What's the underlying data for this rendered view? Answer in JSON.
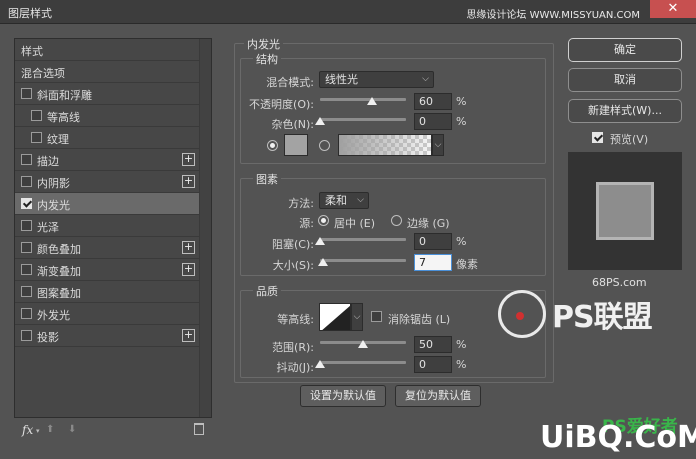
{
  "window": {
    "title": "图层样式",
    "watermark": "思缘设计论坛 WWW.MISSYUAN.COM",
    "close": "✕"
  },
  "styles_list": {
    "header": "样式",
    "blend_options": "混合选项",
    "items": [
      {
        "label": "斜面和浮雕",
        "checked": false
      },
      {
        "label": "等高线",
        "checked": false
      },
      {
        "label": "纹理",
        "checked": false
      },
      {
        "label": "描边",
        "checked": false
      },
      {
        "label": "内阴影",
        "checked": false
      },
      {
        "label": "内发光",
        "checked": true
      },
      {
        "label": "光泽",
        "checked": false
      },
      {
        "label": "颜色叠加",
        "checked": false
      },
      {
        "label": "渐变叠加",
        "checked": false
      },
      {
        "label": "图案叠加",
        "checked": false
      },
      {
        "label": "外发光",
        "checked": false
      },
      {
        "label": "投影",
        "checked": false
      }
    ],
    "fx": "fx",
    "fx_caret": "▾",
    "up_arrow": "⬆",
    "down_arrow": "⬇",
    "plus": "+"
  },
  "inner_glow": {
    "title": "内发光",
    "structure": {
      "title": "结构",
      "blend_mode_label": "混合模式:",
      "blend_mode_value": "线性光",
      "opacity_label": "不透明度(O):",
      "opacity_value": "60",
      "opacity_level": 0.6,
      "noise_label": "杂色(N):",
      "noise_value": "0",
      "noise_level": 0,
      "unit": "%",
      "swatch_color": "#a3a3a3"
    },
    "elements": {
      "title": "图素",
      "method_label": "方法:",
      "method_value": "柔和",
      "source_label": "源:",
      "source_center": "居中 (E)",
      "source_edge": "边缘 (G)",
      "choke_label": "阻塞(C):",
      "choke_value": "0",
      "choke_level": 0,
      "size_label": "大小(S):",
      "size_value": "7",
      "size_level": 0.03,
      "unit": "%",
      "size_unit": "像素"
    },
    "quality": {
      "title": "品质",
      "contour_label": "等高线:",
      "antialias_label": "消除锯齿 (L)",
      "range_label": "范围(R):",
      "range_value": "50",
      "range_level": 0.5,
      "jitter_label": "抖动(J):",
      "jitter_value": "0",
      "jitter_level": 0,
      "unit": "%"
    },
    "set_default": "设置为默认值",
    "reset_default": "复位为默认值"
  },
  "buttons": {
    "ok": "确定",
    "cancel": "取消",
    "new_style": "新建样式(W)...",
    "preview": "预览(V)"
  },
  "watermarks": {
    "site": "68PS.com",
    "brand": "PS联盟",
    "bottom": "UiBQ.CoM",
    "bottom_cn": "PS爱好者"
  },
  "chevron": "⌵"
}
